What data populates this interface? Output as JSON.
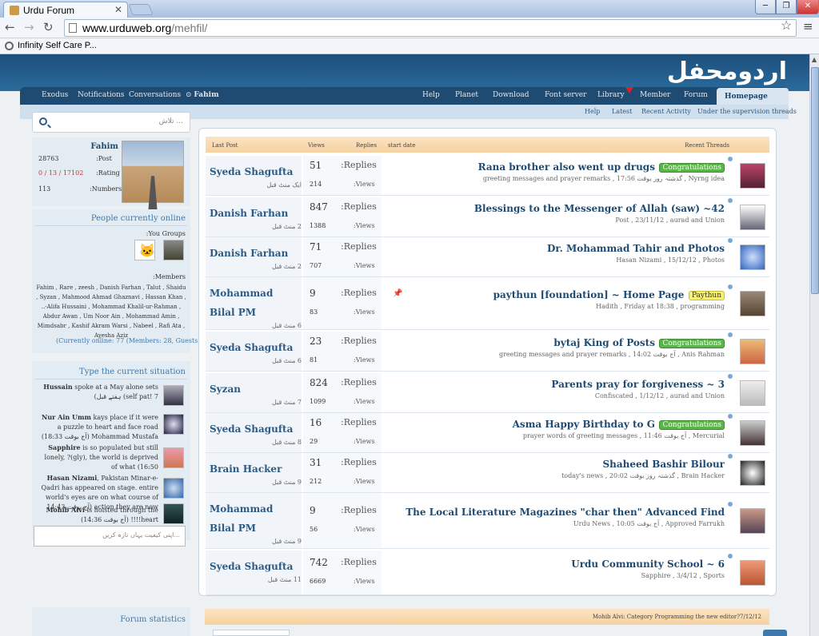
{
  "browser": {
    "tab_title": "Urdu Forum",
    "url_host": "www.urduweb.org",
    "url_path": "/mehfil/",
    "bookmark": "Infinity Self Care P..."
  },
  "site": {
    "logo": "اردومحفل"
  },
  "nav": {
    "left": [
      "Exodus",
      "Notifications",
      "Conversations",
      "Fahim"
    ],
    "right": [
      "Help",
      "Planet",
      "Download",
      "Font server",
      "Library",
      "Member",
      "Forum",
      "Homepage"
    ]
  },
  "subnav": [
    "Help",
    "Latest",
    "Recent Activity",
    "Under the supervision threads"
  ],
  "search": {
    "placeholder": "تلاش ..."
  },
  "user": {
    "name": "Fahim",
    "post_label": ":Post",
    "post_value": "28763",
    "rating_label": ":Rating",
    "rating_value": "0 / 13 / 17102",
    "numbers_label": ":Numbers",
    "numbers_value": "113"
  },
  "online": {
    "heading": "People currently online",
    "groups_label": ":You Groups",
    "members_label": ":Members",
    "members_list": "Fahim , Rare , zeesh , Danish Farhan , Talut , Shaidu , Syzan , Mahmood Ahmad Ghaznavi , Hassan Khan , ..-Alifa Hussaini , Mohammad Khalil-ur-Rahman , Abdur Awan , Um Noor Ain , Mohammad Amin , Mimdsabr , Kashif Akram Warsi , Nabeel , Rafi Ata , Ayesha Aziz",
    "summary": "(Currently online: 77 (Members: 28, Guests: 49"
  },
  "situation": {
    "heading": "Type the current situation",
    "items": [
      {
        "user": "Hussain",
        "text": "spoke at a May alone sets self pat!",
        "time": "7) ہفتے قبل)"
      },
      {
        "user": "Nur Ain Umm",
        "text": "kays place if it were a puzzle to heart and face road Mohammad Mustafa",
        "time": "(آج بوقت 18:33)"
      },
      {
        "user": "Sapphire",
        "text": "is so populated but still lonely, ?(gly), the world is deprived of what",
        "time": "(16:50"
      },
      {
        "user": "Hasan Nizami",
        "text": "Pakistan Minar-e-Qadri has appeared on stage. entire world's eyes are on what course of action they are now",
        "time": "(آج بوقت 14:43"
      },
      {
        "user": "Mohib Alvi",
        "text": "is hoisted through the heart!!!!",
        "time": "(آج بوقت 14:36)"
      }
    ],
    "input_placeholder": "اپنی کیفیت یہاں تازہ کریں..."
  },
  "stats": {
    "heading": "Forum statistics"
  },
  "table": {
    "headers": {
      "last_post": "Last Post",
      "views": "Views",
      "replies": "Replies",
      "start_date": "start date",
      "recent": "Recent Threads"
    },
    "rows": [
      {
        "poster": "Syeda Shagufta",
        "when": "ایک منٹ قبل",
        "replies": "51",
        "views": "214",
        "title": "Rana brother also went up drugs",
        "badge": "Congratulations",
        "badge_type": "green",
        "meta": "greeting messages and prayer remarks , 17:56 گذشتہ روز بوقت , Nyrng idea",
        "pinned": false
      },
      {
        "poster": "Danish Farhan",
        "when": "2 منٹ قبل",
        "replies": "847",
        "views": "1388",
        "title": "Blessings to the Messenger of Allah (saw) ~42",
        "badge": "",
        "badge_type": "",
        "meta": "Post , 23/11/12 , aurad and Union",
        "pinned": false
      },
      {
        "poster": "Danish Farhan",
        "when": "2 منٹ قبل",
        "replies": "71",
        "views": "707",
        "title": "Dr. Mohammad Tahir and Photos",
        "badge": "",
        "badge_type": "",
        "meta": "Hasan Nizami , 15/12/12 , Photos",
        "pinned": false
      },
      {
        "poster": "Mohammad Bilal PM",
        "when": "6 منٹ قبل",
        "replies": "9",
        "views": "83",
        "title": "paythun [foundation] ~ Home Page",
        "badge": "Paythun",
        "badge_type": "yellow",
        "meta": "Hadith , Friday at 18:38 , programming",
        "pinned": true
      },
      {
        "poster": "Syeda Shagufta",
        "when": "6 منٹ قبل",
        "replies": "23",
        "views": "81",
        "title": "bytaj King of Posts",
        "badge": "Congratulations",
        "badge_type": "green",
        "meta": "greeting messages and prayer remarks , آج بوقت 14:02 , Anis Rahman",
        "pinned": false
      },
      {
        "poster": "Syzan",
        "when": "7 منٹ قبل",
        "replies": "824",
        "views": "1099",
        "title": "Parents pray for forgiveness ~ 3",
        "badge": "",
        "badge_type": "",
        "meta": "Confiscated , 1/12/12 , aurad and Union",
        "pinned": false
      },
      {
        "poster": "Syeda Shagufta",
        "when": "8 منٹ قبل",
        "replies": "16",
        "views": "29",
        "title": "Asma Happy Birthday to G",
        "badge": "Congratulations",
        "badge_type": "green",
        "meta": "prayer words of greeting messages , آج بوقت 11:46 , Mercurial",
        "pinned": false
      },
      {
        "poster": "Brain Hacker",
        "when": "9 منٹ قبل",
        "replies": "31",
        "views": "212",
        "title": "Shaheed Bashir Bilour",
        "badge": "",
        "badge_type": "",
        "meta": "today's news , گذشتہ روز بوقت 20:02 , Brain Hacker",
        "pinned": false
      },
      {
        "poster": "Mohammad Bilal PM",
        "when": "9 منٹ قبل",
        "replies": "9",
        "views": "56",
        "title": "The Local Literature Magazines \"char then\" Advanced Find",
        "badge": "",
        "badge_type": "",
        "meta": "Urdu News , آج بوقت 10:05 , Approved Farrukh",
        "pinned": false
      },
      {
        "poster": "Syeda Shagufta",
        "when": "11 منٹ قبل",
        "replies": "742",
        "views": "6669",
        "title": "Urdu Community School ~ 6",
        "badge": "",
        "badge_type": "",
        "meta": "Sapphire , 3/4/12 , Sports",
        "pinned": false
      }
    ],
    "replies_label": ":Replies",
    "views_label": ":Views"
  },
  "bottom_bar": "Mohib Alvi: Category Programming the new editor?7/12/12",
  "colors": {
    "banner": "#1d4f7c",
    "nav": "#1f4a71",
    "link": "#2d5a85",
    "badge_green": "#5ab44a",
    "badge_yellow": "#f8f070"
  }
}
